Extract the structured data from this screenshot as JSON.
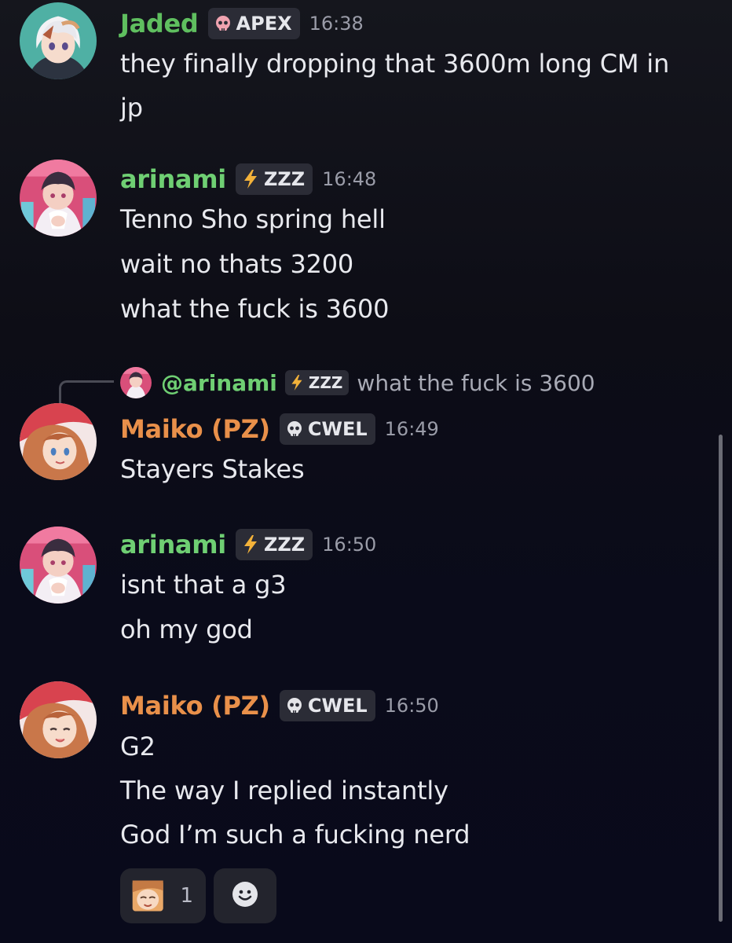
{
  "colors": {
    "jaded_name": "#5fbf5f",
    "arinami_name": "#6fcf73",
    "maiko_name": "#e9904a",
    "tag_bg": "#2b2c36",
    "timestamp": "#9a9ca8",
    "message_text": "#e8e9ee"
  },
  "messages": [
    {
      "author": "Jaded",
      "tag_icon": "skull-icon",
      "tag": "APEX",
      "time": "16:38",
      "lines": [
        "they finally dropping that 3600m long CM in",
        "jp"
      ]
    },
    {
      "author": "arinami",
      "tag_icon": "lightning-icon",
      "tag": "ZZZ",
      "time": "16:48",
      "lines": [
        "Tenno Sho spring hell",
        "wait no thats 3200",
        "what the fuck is 3600"
      ]
    },
    {
      "author": "Maiko (PZ)",
      "tag_icon": "skull-icon",
      "tag": "CWEL",
      "time": "16:49",
      "reply": {
        "author": "@arinami",
        "tag_icon": "lightning-icon",
        "tag": "ZZZ",
        "text": "what the fuck is 3600"
      },
      "lines": [
        "Stayers Stakes"
      ]
    },
    {
      "author": "arinami",
      "tag_icon": "lightning-icon",
      "tag": "ZZZ",
      "time": "16:50",
      "lines": [
        "isnt that a g3",
        "oh my god"
      ]
    },
    {
      "author": "Maiko (PZ)",
      "tag_icon": "skull-icon",
      "tag": "CWEL",
      "time": "16:50",
      "lines": [
        "G2",
        "The way I replied instantly",
        "God I’m such a fucking nerd"
      ]
    }
  ],
  "reactions": [
    {
      "emoji": "anime-face-emoji-icon",
      "count": "1"
    },
    {
      "emoji": "add-reaction-smiley-icon",
      "count": ""
    }
  ]
}
